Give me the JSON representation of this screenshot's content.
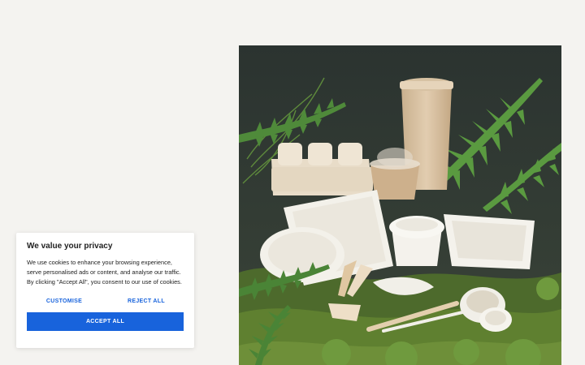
{
  "cookie_banner": {
    "title": "We value your privacy",
    "text": "We use cookies to enhance your browsing experience, serve personalised ads or content, and analyse our traffic. By clicking \"Accept All\", you consent to our use of cookies.",
    "customise_label": "CUSTOMISE",
    "reject_label": "REJECT ALL",
    "accept_label": "ACCEPT ALL"
  },
  "colors": {
    "page_background": "#f4f3f0",
    "accent": "#1863dc",
    "photo_background": "#2f3735",
    "fern": "#4f8a3a",
    "moss": "#5f8030",
    "product_kraft": "#d9c4a8",
    "product_white": "#f3f1ea"
  },
  "hero_image": {
    "subject": "compostable tableware among ferns and moss",
    "icon": "product-photo"
  }
}
